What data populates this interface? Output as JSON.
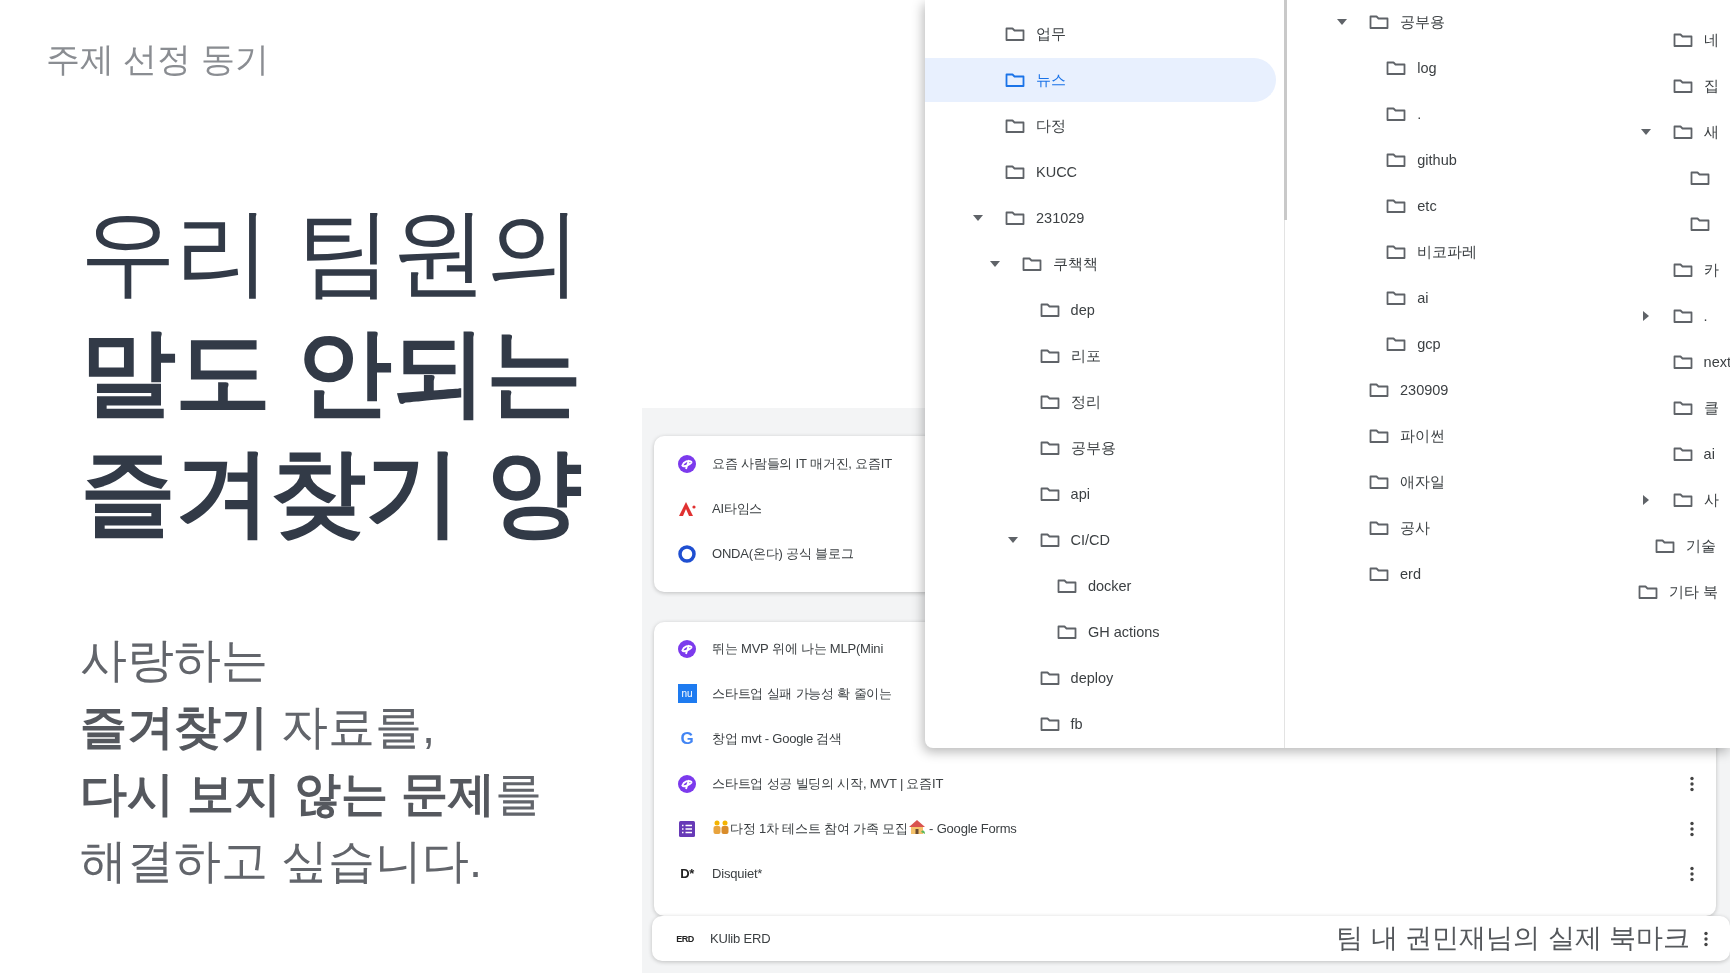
{
  "slide": {
    "title": "주제 선정 동기",
    "heading": [
      {
        "text": "우리 팀원의",
        "bold": false
      },
      {
        "text": "말도 안되는",
        "bold": true
      },
      {
        "text": "즐겨찾기 양",
        "bold": true
      }
    ],
    "paragraph": "사랑하는\n**즐겨찾기** 자료를,\n**다시 보지 않는 문제**를\n해결하고 싶습니다.",
    "caption": "팀 내 권민재님의 실제 북마크"
  },
  "bookmark_list": {
    "cards": [
      {
        "rows": [
          {
            "favicon": {
              "kind": "swirl"
            },
            "segments": [
              {
                "kind": "text",
                "text": "요즘 사람들의 IT 매거진, 요즘IT"
              }
            ],
            "menu": false
          },
          {
            "favicon": {
              "kind": "peak"
            },
            "segments": [
              {
                "kind": "text",
                "text": "AI타임스"
              }
            ],
            "menu": false
          },
          {
            "favicon": {
              "kind": "ring"
            },
            "segments": [
              {
                "kind": "text",
                "text": "ONDA(온다) 공식 블로그"
              }
            ],
            "menu": false
          }
        ]
      },
      {
        "rows": [
          {
            "favicon": {
              "kind": "swirl"
            },
            "segments": [
              {
                "kind": "text",
                "text": "뛰는 MVP 위에 나는 MLP(Mini"
              }
            ],
            "menu": false
          },
          {
            "favicon": {
              "kind": "tile",
              "text": "nu"
            },
            "segments": [
              {
                "kind": "text",
                "text": "스타트업 실패 가능성 확 줄이는"
              }
            ],
            "menu": false
          },
          {
            "favicon": {
              "kind": "letter",
              "text": "G"
            },
            "segments": [
              {
                "kind": "text",
                "text": "창업 mvt - Google 검색"
              }
            ],
            "menu": false
          },
          {
            "favicon": {
              "kind": "swirl"
            },
            "segments": [
              {
                "kind": "text",
                "text": "스타트업 성공 빌딩의 시작, MVT | 요즘IT"
              }
            ],
            "menu": true
          },
          {
            "favicon": {
              "kind": "form"
            },
            "segments": [
              {
                "kind": "people"
              },
              {
                "kind": "text",
                "text": "다정 1차 테스트 참여 가족 모집"
              },
              {
                "kind": "house"
              },
              {
                "kind": "text",
                "text": " - Google Forms"
              }
            ],
            "menu": true
          },
          {
            "favicon": {
              "kind": "mono",
              "text": "D*"
            },
            "segments": [
              {
                "kind": "text",
                "text": "Disquiet*"
              }
            ],
            "menu": true
          }
        ]
      },
      {
        "rows": [
          {
            "favicon": {
              "kind": "mono",
              "text": "ERD"
            },
            "segments": [
              {
                "kind": "text",
                "text": "KUlib ERD"
              }
            ],
            "menu": true
          }
        ]
      }
    ]
  },
  "folder_tree": {
    "columns": [
      {
        "items": [
          {
            "label": "업무",
            "selected": false
          },
          {
            "label": "뉴스",
            "selected": true
          },
          {
            "label": "다정",
            "selected": false
          },
          {
            "label": "KUCC",
            "selected": false
          },
          {
            "label": "231029",
            "selected": false,
            "expanded": true,
            "children": [
              {
                "label": "쿠책책",
                "selected": false,
                "expanded": true,
                "children": [
                  {
                    "label": "dep",
                    "selected": false
                  },
                  {
                    "label": "리포",
                    "selected": false
                  },
                  {
                    "label": "정리",
                    "selected": false
                  },
                  {
                    "label": "공부용",
                    "selected": false
                  },
                  {
                    "label": "api",
                    "selected": false
                  },
                  {
                    "label": "CI/CD",
                    "selected": false,
                    "expanded": true,
                    "children": [
                      {
                        "label": "docker",
                        "selected": false
                      },
                      {
                        "label": "GH actions",
                        "selected": false
                      }
                    ]
                  },
                  {
                    "label": "deploy",
                    "selected": false
                  },
                  {
                    "label": "fb",
                    "selected": false
                  }
                ]
              }
            ]
          }
        ]
      },
      {
        "items": [
          {
            "label": "공부용",
            "selected": false,
            "expanded": true,
            "children": [
              {
                "label": "log",
                "selected": false
              },
              {
                "label": ".",
                "selected": false
              },
              {
                "label": "github",
                "selected": false
              },
              {
                "label": "etc",
                "selected": false
              },
              {
                "label": "비코파레",
                "selected": false
              },
              {
                "label": "ai",
                "selected": false
              },
              {
                "label": "gcp",
                "selected": false
              }
            ]
          },
          {
            "label": "230909",
            "selected": false
          },
          {
            "label": "파이썬",
            "selected": false
          },
          {
            "label": "애자일",
            "selected": false
          },
          {
            "label": "공사",
            "selected": false
          },
          {
            "label": "erd",
            "selected": false
          }
        ]
      },
      {
        "items": [
          {
            "children": [
              {
                "children": [
                  {
                    "label": "네",
                    "selected": false
                  },
                  {
                    "label": "집",
                    "selected": false
                  },
                  {
                    "label": "새",
                    "selected": false,
                    "expanded": true,
                    "children": [
                      {
                        "selected": false
                      },
                      {
                        "selected": false
                      }
                    ]
                  },
                  {
                    "label": "카",
                    "selected": false
                  },
                  {
                    "label": ".",
                    "selected": false,
                    "expanded": false
                  },
                  {
                    "label": "next",
                    "selected": false
                  },
                  {
                    "label": "클",
                    "selected": false
                  },
                  {
                    "label": "ai",
                    "selected": false
                  },
                  {
                    "label": "사",
                    "selected": false,
                    "expanded": false
                  }
                ]
              },
              {
                "label": "기술",
                "selected": false
              }
            ]
          },
          {
            "label": "기타 북",
            "selected": false
          }
        ]
      }
    ]
  }
}
